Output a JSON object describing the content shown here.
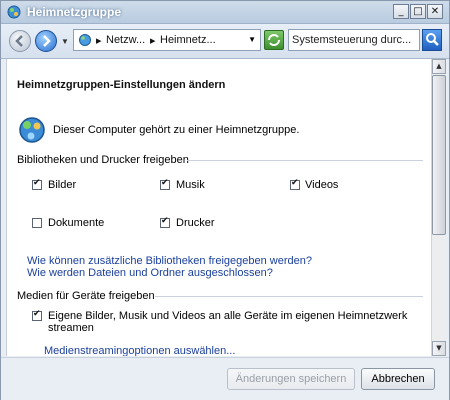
{
  "window": {
    "title": "Heimnetzgruppe"
  },
  "address": {
    "crumbs": [
      "Netzw...",
      "Heimnetz..."
    ],
    "search_value": "Systemsteuerung durc..."
  },
  "page": {
    "heading": "Heimnetzgruppen-Einstellungen ändern",
    "info_text": "Dieser Computer gehört zu einer Heimnetzgruppe."
  },
  "libraries": {
    "title": "Bibliotheken und Drucker freigeben",
    "items": [
      {
        "label": "Bilder",
        "checked": true
      },
      {
        "label": "Musik",
        "checked": true
      },
      {
        "label": "Videos",
        "checked": true
      },
      {
        "label": "Dokumente",
        "checked": false
      },
      {
        "label": "Drucker",
        "checked": true
      }
    ],
    "link1": "Wie können zusätzliche Bibliotheken freigegeben werden?",
    "link2": "Wie werden Dateien und Ordner ausgeschlossen?"
  },
  "media": {
    "title": "Medien für Geräte freigeben",
    "checkbox_line1": "Eigene Bilder, Musik und Videos an alle Geräte im eigenen Heimnetzwerk",
    "checkbox_line2": "streamen",
    "checked": true,
    "link": "Medienstreamingoptionen auswählen..."
  },
  "footer": {
    "save_label": "Änderungen speichern",
    "cancel_label": "Abbrechen"
  },
  "icons": {
    "app": "homegroup-icon",
    "back": "back-arrow-icon",
    "forward": "forward-arrow-icon",
    "refresh": "refresh-icon",
    "search": "search-icon"
  },
  "colors": {
    "link": "#1a3f9c",
    "accent": "#2a6fcf"
  }
}
